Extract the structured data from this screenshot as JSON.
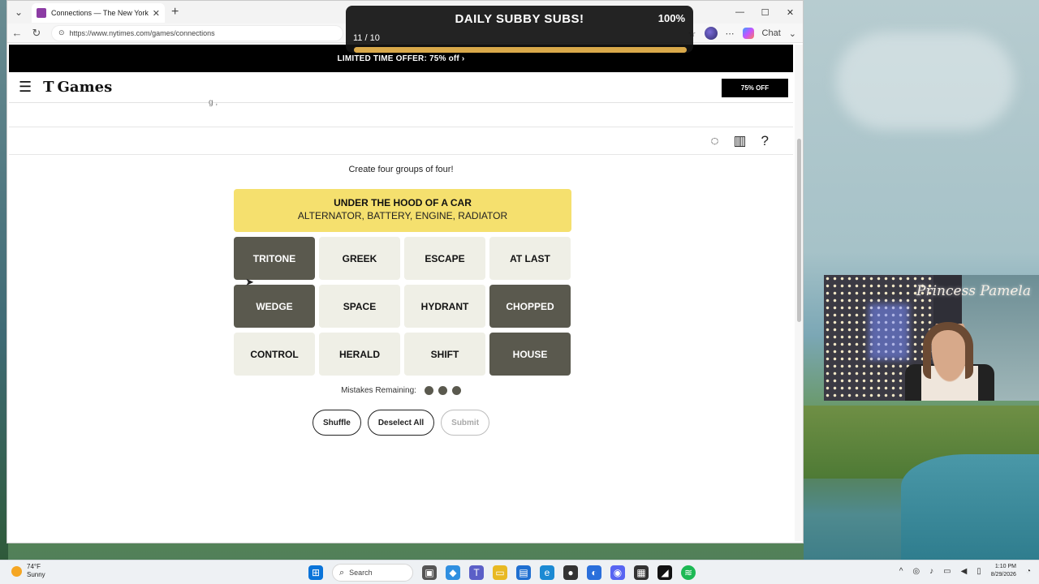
{
  "browser": {
    "tab_title": "Connections — The New York Tim",
    "url": "https://www.nytimes.com/games/connections",
    "chat_label": "Chat",
    "new_tab": "+"
  },
  "site": {
    "promo": "LIMITED TIME OFFER: 75% off ›",
    "logo_text": "Games",
    "logo_mark": "T",
    "offer_button": "75% OFF",
    "subtitle_fragment": "g     ,"
  },
  "game": {
    "instructions": "Create four groups of four!",
    "solved": {
      "name": "UNDER THE HOOD OF A CAR",
      "words": "ALTERNATOR, BATTERY, ENGINE, RADIATOR",
      "color": "#f5e06e"
    },
    "tiles": [
      {
        "word": "TRITONE",
        "selected": true
      },
      {
        "word": "GREEK",
        "selected": false
      },
      {
        "word": "ESCAPE",
        "selected": false
      },
      {
        "word": "AT LAST",
        "selected": false
      },
      {
        "word": "WEDGE",
        "selected": true
      },
      {
        "word": "SPACE",
        "selected": false
      },
      {
        "word": "HYDRANT",
        "selected": false
      },
      {
        "word": "CHOPPED",
        "selected": true
      },
      {
        "word": "CONTROL",
        "selected": false
      },
      {
        "word": "HERALD",
        "selected": false
      },
      {
        "word": "SHIFT",
        "selected": false
      },
      {
        "word": "HOUSE",
        "selected": true
      }
    ],
    "mistakes_label": "Mistakes Remaining:",
    "mistakes_remaining": 3,
    "buttons": {
      "shuffle": "Shuffle",
      "deselect": "Deselect All",
      "submit": "Submit"
    }
  },
  "overlay": {
    "title": "DAILY SUBBY SUBS!",
    "percent": "100%",
    "count": "11 / 10",
    "progress": 1.0
  },
  "webcam": {
    "name": "Princess Pamela"
  },
  "taskbar": {
    "temp": "74°F",
    "condition": "Sunny",
    "search_placeholder": "Search",
    "time": "1:10 PM",
    "date": "8/29/2026"
  },
  "colors": {
    "selected_tile": "#5a594e",
    "default_tile": "#efefe6",
    "accent_progress": "#d9a94a"
  }
}
